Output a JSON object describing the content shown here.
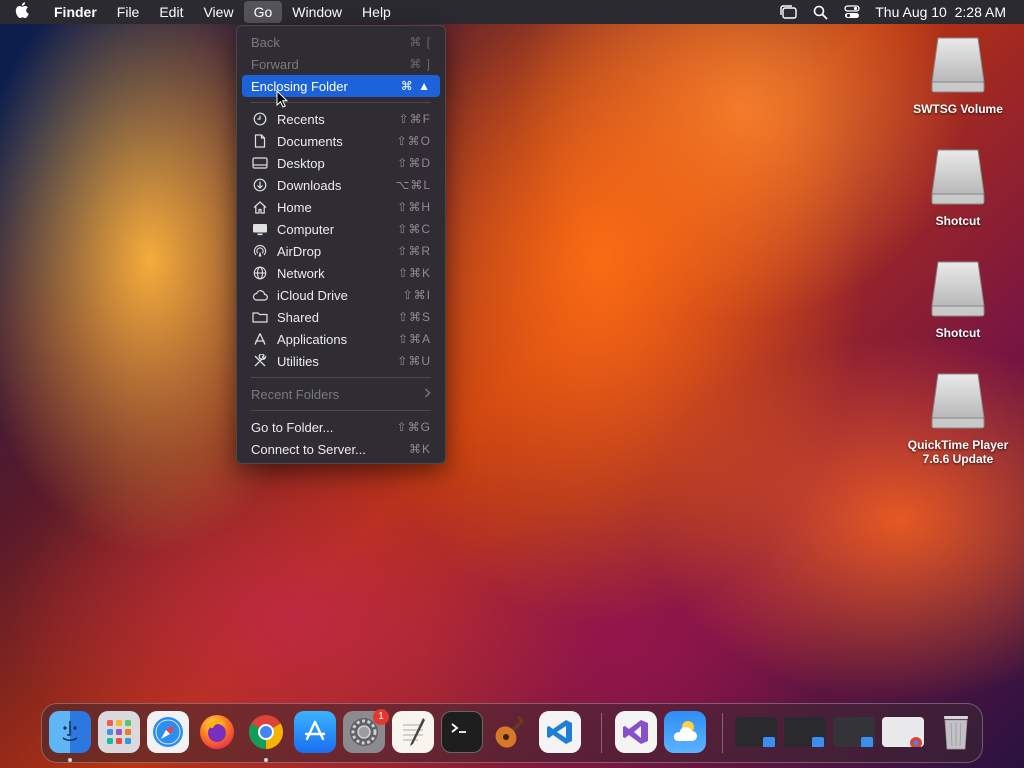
{
  "menubar": {
    "app_name": "Finder",
    "menus": [
      "File",
      "Edit",
      "View",
      "Go",
      "Window",
      "Help"
    ],
    "datetime": "Thu Aug 10  2:28 AM"
  },
  "go_menu": {
    "back": {
      "label": "Back",
      "shortcut": "⌘ ["
    },
    "forward": {
      "label": "Forward",
      "shortcut": "⌘ ]"
    },
    "enclosing": {
      "label": "Enclosing Folder",
      "shortcut": "⌘ ▲"
    },
    "places": [
      {
        "label": "Recents",
        "shortcut": "⇧⌘F",
        "icon": "clock-icon"
      },
      {
        "label": "Documents",
        "shortcut": "⇧⌘O",
        "icon": "document-icon"
      },
      {
        "label": "Desktop",
        "shortcut": "⇧⌘D",
        "icon": "desktop-icon"
      },
      {
        "label": "Downloads",
        "shortcut": "⌥⌘L",
        "icon": "download-icon"
      },
      {
        "label": "Home",
        "shortcut": "⇧⌘H",
        "icon": "home-icon"
      },
      {
        "label": "Computer",
        "shortcut": "⇧⌘C",
        "icon": "computer-icon"
      },
      {
        "label": "AirDrop",
        "shortcut": "⇧⌘R",
        "icon": "airdrop-icon"
      },
      {
        "label": "Network",
        "shortcut": "⇧⌘K",
        "icon": "network-icon"
      },
      {
        "label": "iCloud Drive",
        "shortcut": "⇧⌘I",
        "icon": "cloud-icon"
      },
      {
        "label": "Shared",
        "shortcut": "⇧⌘S",
        "icon": "shared-folder-icon"
      },
      {
        "label": "Applications",
        "shortcut": "⇧⌘A",
        "icon": "applications-icon"
      },
      {
        "label": "Utilities",
        "shortcut": "⇧⌘U",
        "icon": "utilities-icon"
      }
    ],
    "recent_folders": "Recent Folders",
    "goto": {
      "label": "Go to Folder...",
      "shortcut": "⇧⌘G"
    },
    "connect": {
      "label": "Connect to Server...",
      "shortcut": "⌘K"
    }
  },
  "desktop_icons": [
    {
      "label": "SWTSG Volume"
    },
    {
      "label": "Shotcut"
    },
    {
      "label": "Shotcut"
    },
    {
      "label": "QuickTime Player 7.6.6 Update"
    }
  ],
  "dock": {
    "settings_badge": "1"
  },
  "colors": {
    "menu_highlight": "#1c63db",
    "menubar_bg": "#2b2a30",
    "menu_bg": "#2f2d33"
  }
}
